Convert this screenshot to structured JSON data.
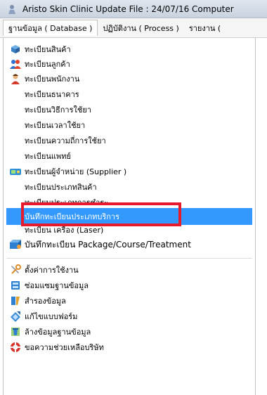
{
  "window": {
    "title": "Aristo Skin Clinic  Update File : 24/07/16 Computer"
  },
  "menubar": {
    "items": [
      {
        "label": "ฐานข้อมูล ( Database )",
        "open": true
      },
      {
        "label": "ปฏิบัติงาน ( Process )",
        "open": false
      },
      {
        "label": "รายงาน (",
        "open": false
      }
    ]
  },
  "dropdown": {
    "items": [
      {
        "label": "ทะเบียนสินค้า",
        "icon": "box-icon"
      },
      {
        "label": "ทะเบียนลูกค้า",
        "icon": "customers-icon"
      },
      {
        "label": "ทะเบียนพนักงาน",
        "icon": "employee-icon"
      },
      {
        "label": "ทะเบียนธนาคาร",
        "icon": ""
      },
      {
        "label": "ทะเบียนวิธีการใช้ยา",
        "icon": ""
      },
      {
        "label": "ทะเบียนเวลาใช้ยา",
        "icon": ""
      },
      {
        "label": "ทะเบียนความถี่การใช้ยา",
        "icon": ""
      },
      {
        "label": "ทะเบียนแพทย์",
        "icon": ""
      },
      {
        "label": "ทะเบียนผู้จำหน่าย (Supplier )",
        "icon": "supplier-icon"
      },
      {
        "label": "ทะเบียนประเภทสินค้า",
        "icon": ""
      },
      {
        "label": "ทะเบียนประเภทการชำระ",
        "icon": ""
      },
      {
        "label": "บันทึกทะเบียนประเภทบริการ",
        "icon": "",
        "selected": true
      },
      {
        "label": "ทะเบียน เครื่อง (Laser)",
        "icon": ""
      },
      {
        "label": "บันทึกทะเบียน Package/Course/Treatment",
        "icon": "package-icon"
      },
      {
        "label": "ตั้งค่าการใช้งาน",
        "icon": "settings-icon"
      },
      {
        "label": "ซ่อมแซมฐานข้อมูล",
        "icon": "repair-db-icon"
      },
      {
        "label": "สำรองข้อมูล",
        "icon": "backup-icon"
      },
      {
        "label": "แก้ไขแบบฟอร์ม",
        "icon": "edit-form-icon"
      },
      {
        "label": "ล้างข้อมูลฐานข้อมูล",
        "icon": "clear-db-icon"
      },
      {
        "label": "ขอความช่วยเหลือบริษัท",
        "icon": "help-icon"
      }
    ]
  },
  "colors": {
    "selection": "#3399ff",
    "highlight_box": "#e8192c"
  }
}
